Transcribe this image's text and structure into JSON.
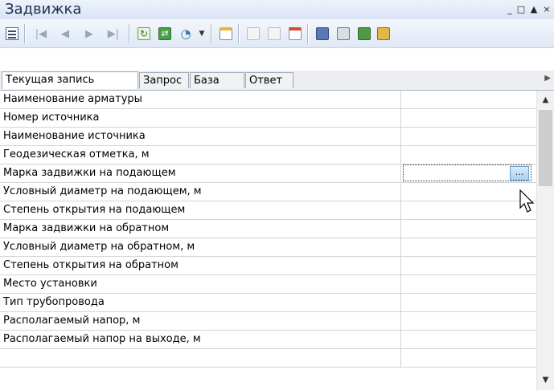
{
  "window": {
    "title": "Задвижка",
    "controls": [
      "_",
      "□",
      "▲",
      "×"
    ]
  },
  "toolbar": {
    "buttons": [
      {
        "name": "view-grid",
        "enabled": true
      },
      {
        "name": "first-record",
        "enabled": false
      },
      {
        "name": "prev-record",
        "enabled": false
      },
      {
        "name": "next-record",
        "enabled": false
      },
      {
        "name": "last-record",
        "enabled": false
      },
      {
        "name": "refresh",
        "enabled": true
      },
      {
        "name": "sync",
        "enabled": true
      },
      {
        "name": "search",
        "enabled": true
      },
      {
        "name": "new-record",
        "enabled": true
      },
      {
        "name": "edit-record",
        "enabled": false
      },
      {
        "name": "copy-record",
        "enabled": false
      },
      {
        "name": "delete-record",
        "enabled": true
      },
      {
        "name": "save",
        "enabled": true
      },
      {
        "name": "print",
        "enabled": true
      },
      {
        "name": "export",
        "enabled": true
      },
      {
        "name": "report",
        "enabled": true
      }
    ]
  },
  "tabs": [
    {
      "label": "Текущая запись",
      "active": true
    },
    {
      "label": "Запрос",
      "active": false
    },
    {
      "label": "База",
      "active": false
    },
    {
      "label": "Ответ",
      "active": false
    }
  ],
  "rows": [
    {
      "name": "Наименование арматуры",
      "value": ""
    },
    {
      "name": "Номер источника",
      "value": ""
    },
    {
      "name": "Наименование источника",
      "value": ""
    },
    {
      "name": "Геодезическая отметка, м",
      "value": ""
    },
    {
      "name": "Марка задвижки на подающем",
      "value": "",
      "editing": true,
      "button_label": "..."
    },
    {
      "name": "Условный диаметр на подающем, м",
      "value": ""
    },
    {
      "name": "Степень открытия на подающем",
      "value": ""
    },
    {
      "name": "Марка задвижки на обратном",
      "value": ""
    },
    {
      "name": "Условный диаметр на обратном, м",
      "value": ""
    },
    {
      "name": "Степень открытия на обратном",
      "value": ""
    },
    {
      "name": "Место установки",
      "value": ""
    },
    {
      "name": "Тип трубопровода",
      "value": ""
    },
    {
      "name": "Располагаемый напор, м",
      "value": ""
    },
    {
      "name": "Располагаемый напор на выходе, м",
      "value": ""
    },
    {
      "name": "",
      "value": ""
    }
  ],
  "scrollbar": {
    "position": 0.0,
    "visible_fraction": 0.3
  },
  "colors": {
    "title_text": "#1d2f52",
    "toolbar_bg": "#e5ecf6",
    "grid_line": "#d4d4d4"
  }
}
